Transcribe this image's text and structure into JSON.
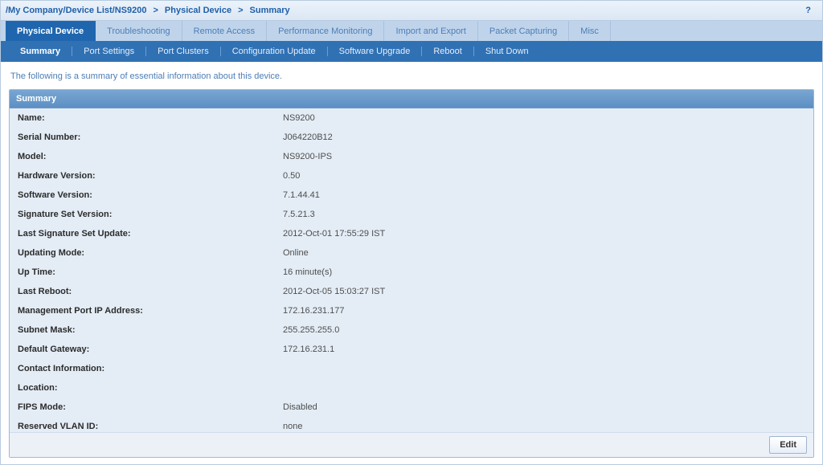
{
  "breadcrumb": {
    "items": [
      {
        "label": "/My Company/Device List/NS9200"
      },
      {
        "label": "Physical Device"
      },
      {
        "label": "Summary"
      }
    ],
    "link_count": 2,
    "sep": ">"
  },
  "help": "?",
  "tabs_primary": [
    {
      "label": "Physical Device",
      "active": true
    },
    {
      "label": "Troubleshooting"
    },
    {
      "label": "Remote Access"
    },
    {
      "label": "Performance Monitoring"
    },
    {
      "label": "Import and Export"
    },
    {
      "label": "Packet Capturing"
    },
    {
      "label": "Misc"
    }
  ],
  "tabs_secondary": [
    {
      "label": "Summary",
      "active": true
    },
    {
      "label": "Port Settings"
    },
    {
      "label": "Port Clusters"
    },
    {
      "label": "Configuration Update"
    },
    {
      "label": "Software Upgrade"
    },
    {
      "label": "Reboot"
    },
    {
      "label": "Shut Down"
    }
  ],
  "intro": "The following is a summary of essential information about this device.",
  "panel": {
    "title": "Summary",
    "edit_label": "Edit",
    "rows": [
      {
        "k": "Name:",
        "v": "NS9200"
      },
      {
        "k": "Serial Number:",
        "v": "J064220B12"
      },
      {
        "k": "Model:",
        "v": "NS9200-IPS"
      },
      {
        "k": "Hardware Version:",
        "v": "0.50"
      },
      {
        "k": "Software Version:",
        "v": "7.1.44.41"
      },
      {
        "k": "Signature Set Version:",
        "v": "7.5.21.3"
      },
      {
        "k": "Last Signature Set Update:",
        "v": "2012-Oct-01 17:55:29 IST"
      },
      {
        "k": "Updating Mode:",
        "v": "Online"
      },
      {
        "k": "Up Time:",
        "v": "16 minute(s)"
      },
      {
        "k": "Last Reboot:",
        "v": "2012-Oct-05 15:03:27 IST"
      },
      {
        "k": "Management Port IP Address:",
        "v": "172.16.231.177"
      },
      {
        "k": "Subnet Mask:",
        "v": "255.255.255.0"
      },
      {
        "k": "Default Gateway:",
        "v": "172.16.231.1"
      },
      {
        "k": "Contact Information:",
        "v": ""
      },
      {
        "k": "Location:",
        "v": ""
      },
      {
        "k": "FIPS Mode:",
        "v": "Disabled"
      },
      {
        "k": "Reserved VLAN ID:",
        "v": "none"
      }
    ]
  }
}
